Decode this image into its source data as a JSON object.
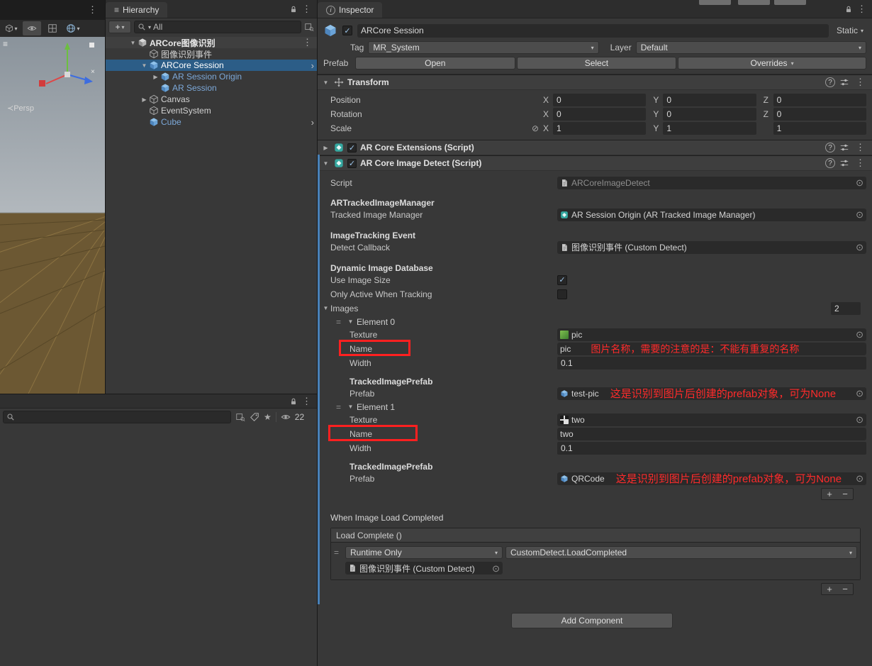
{
  "colors": {
    "selection_blue": "#2C5D87",
    "prefab_text_blue": "#7CA8D8",
    "override_bar_blue": "#4881B8",
    "annotation_red": "#FF2B2B",
    "panel_background": "#383838"
  },
  "icons": {
    "kebab": "⋮",
    "menu": "≡",
    "fold_open": "▼",
    "fold_closed": "▶",
    "dropdown": "▾",
    "check": "✓",
    "picker": "⊙",
    "arrow_right": "›",
    "plus": "+",
    "minus": "−",
    "help": "?",
    "link": "⊘",
    "drag": "=",
    "star": "★",
    "info": "i",
    "close": "×"
  },
  "scene_view": {
    "persp_label": "≺Persp"
  },
  "hierarchy": {
    "tab_title": "Hierarchy",
    "search_value": "All",
    "scene_item": {
      "label": "ARCore图像识别"
    },
    "items": [
      {
        "label": "图像识别事件"
      },
      {
        "label": "ARCore Session"
      },
      {
        "label": "AR Session Origin"
      },
      {
        "label": "AR Session"
      },
      {
        "label": "Canvas"
      },
      {
        "label": "EventSystem"
      },
      {
        "label": "Cube"
      }
    ]
  },
  "project": {
    "search_value": "",
    "hidden_count": "22"
  },
  "inspector": {
    "tab_title": "Inspector",
    "header": {
      "name_value": "ARCore Session",
      "static_label": "Static",
      "tag_label": "Tag",
      "tag_value": "MR_System",
      "layer_label": "Layer",
      "layer_value": "Default",
      "prefab_label": "Prefab",
      "open_button": "Open",
      "select_button": "Select",
      "overrides_button": "Overrides"
    },
    "transform": {
      "title": "Transform",
      "position_label": "Position",
      "rotation_label": "Rotation",
      "scale_label": "Scale",
      "x_label": "X",
      "y_label": "Y",
      "z_label": "Z",
      "position": {
        "x": "0",
        "y": "0",
        "z": "0"
      },
      "rotation": {
        "x": "0",
        "y": "0",
        "z": "0"
      },
      "scale": {
        "x": "1",
        "y": "1",
        "z": "1"
      }
    },
    "ar_core_extensions": {
      "title": "AR Core Extensions (Script)"
    },
    "image_detect": {
      "title": "AR Core Image Detect (Script)",
      "script_label": "Script",
      "script_value": "ARCoreImageDetect",
      "manager_header": "ARTrackedImageManager",
      "manager_label": "Tracked Image Manager",
      "manager_value": "AR Session Origin (AR Tracked Image Manager)",
      "event_header": "ImageTracking Event",
      "callback_label": "Detect Callback",
      "callback_value": "图像识别事件 (Custom Detect)",
      "database_header": "Dynamic Image Database",
      "use_image_size_label": "Use Image Size",
      "only_active_label": "Only Active When Tracking",
      "images_label": "Images",
      "images_count": "2",
      "elements": [
        {
          "title": "Element 0",
          "texture_label": "Texture",
          "texture_value": "pic",
          "name_label": "Name",
          "name_value": "pic",
          "name_annotation": "图片名称，需要的注意的是：不能有重复的名称",
          "width_label": "Width",
          "width_value": "0.1",
          "prefab_header": "TrackedImagePrefab",
          "prefab_label": "Prefab",
          "prefab_value": "test-pic",
          "prefab_annotation": "这是识别到图片后创建的prefab对象，可为None"
        },
        {
          "title": "Element 1",
          "texture_label": "Texture",
          "texture_value": "two",
          "name_label": "Name",
          "name_value": "two",
          "width_label": "Width",
          "width_value": "0.1",
          "prefab_header": "TrackedImagePrefab",
          "prefab_label": "Prefab",
          "prefab_value": "QRCode",
          "prefab_annotation": "这是识别到图片后创建的prefab对象，可为None"
        }
      ],
      "load_completed_label": "When Image Load Completed",
      "event": {
        "title": "Load Complete ()",
        "mode_value": "Runtime Only",
        "function_value": "CustomDetect.LoadCompleted",
        "target_value": "图像识别事件 (Custom Detect)"
      }
    },
    "add_component_button": "Add Component"
  }
}
